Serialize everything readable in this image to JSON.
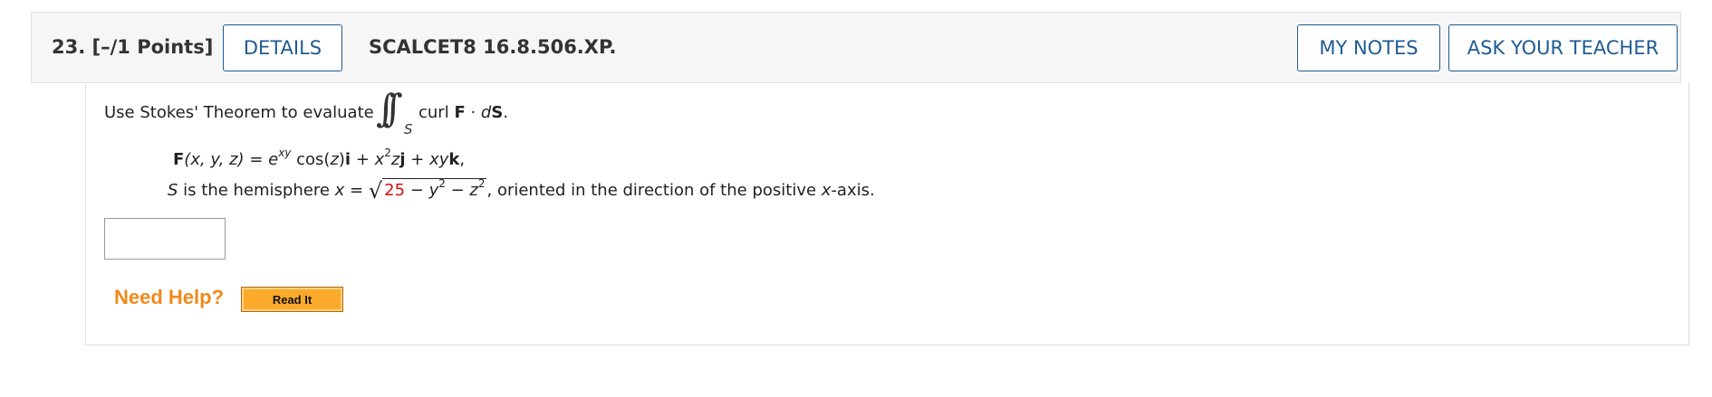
{
  "header": {
    "question_number": "23.",
    "points": "[–/1 Points]",
    "details_label": "DETAILS",
    "code": "SCALCET8 16.8.506.XP.",
    "my_notes_label": "MY NOTES",
    "ask_teacher_label": "ASK YOUR TEACHER"
  },
  "problem": {
    "prompt": "Use Stokes' Theorem to evaluate",
    "integral_symbol": "∫∫",
    "integral_subscript": "S",
    "integrand_curl": "curl ",
    "integrand_F": "F",
    "integrand_dot": " · ",
    "integrand_d": "d",
    "integrand_S": "S",
    "integrand_period": ".",
    "field": {
      "F": "F",
      "args": "(x, y, z)",
      "eq": " = ",
      "e": "e",
      "exp": "xy",
      "cos": " cos(",
      "z1": "z",
      "close": ")",
      "i": "i",
      "plus1": " + ",
      "x2": "x",
      "sq": "2",
      "z2": "z",
      "j": "j",
      "plus2": " + ",
      "xy": "xy",
      "k": "k",
      "comma": ","
    },
    "surface": {
      "S": "S",
      "text1": " is the hemisphere ",
      "x": "x",
      "eq": " = ",
      "radical": "√",
      "r2": "25",
      "minus1": " − ",
      "y": "y",
      "ysq": "2",
      "minus2": " − ",
      "z": "z",
      "zsq": "2",
      "comma": ",",
      "text2": "  oriented in the direction of the positive ",
      "axis": "x",
      "text3": "-axis."
    }
  },
  "answer": {
    "value": ""
  },
  "help": {
    "need_help": "Need Help?",
    "read_it": "Read It"
  },
  "colors": {
    "accent_blue": "#1f5b92",
    "help_orange": "#f0891a",
    "read_it_bg": "#fbaa2b",
    "red_value": "#d11111"
  }
}
